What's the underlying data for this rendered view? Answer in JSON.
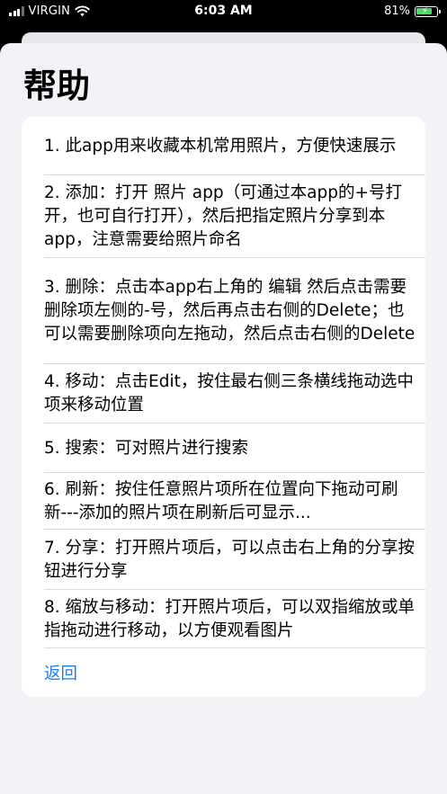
{
  "status_bar": {
    "carrier": "VIRGIN",
    "time": "6:03 AM",
    "battery_percent": "81%",
    "battery_level": 0.81,
    "wifi_icon": "wifi-icon",
    "battery_icon": "battery-charging-icon",
    "charging_color": "#4cd964"
  },
  "page": {
    "title": "帮助"
  },
  "help_items": [
    "1. 此app用来收藏本机常用照片，方便快速展示",
    "2. 添加：打开 照片 app（可通过本app的+号打开，也可自行打开），然后把指定照片分享到本app，注意需要给照片命名",
    "3. 删除：点击本app右上角的 编辑 然后点击需要删除项左侧的-号，然后再点击右侧的Delete；也可以需要删除项向左拖动，然后点击右侧的Delete",
    "4. 移动：点击Edit，按住最右侧三条横线拖动选中项来移动位置",
    "5. 搜索：可对照片进行搜索",
    "6. 刷新：按住任意照片项所在位置向下拖动可刷新---添加的照片项在刷新后可显示...",
    "7. 分享：打开照片项后，可以点击右上角的分享按钮进行分享",
    "8. 缩放与移动：打开照片项后，可以双指缩放或单指拖动进行移动，以方便观看图片"
  ],
  "actions": {
    "back_label": "返回"
  },
  "colors": {
    "accent": "#1a7ff0",
    "sheet_background": "#f2f2f7",
    "card_background": "#ffffff"
  }
}
